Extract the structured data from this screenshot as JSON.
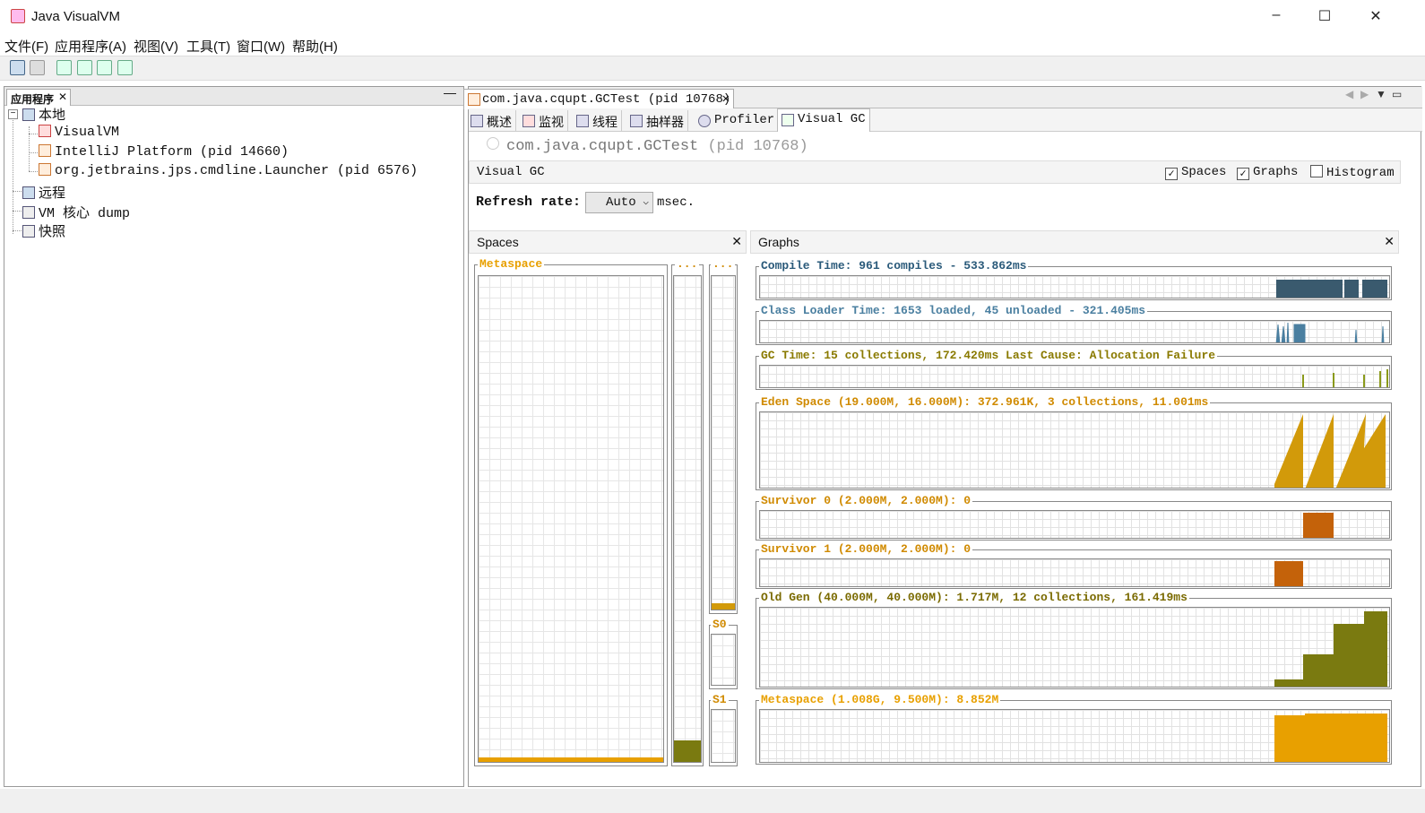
{
  "window": {
    "title": "Java VisualVM",
    "min": "‒",
    "max": "☐",
    "close": "✕"
  },
  "menu": [
    "文件(F)",
    "应用程序(A)",
    "视图(V)",
    "工具(T)",
    "窗口(W)",
    "帮助(H)"
  ],
  "left": {
    "tab_label": "应用程序",
    "tree": {
      "local": "本地",
      "visualvm": "VisualVM",
      "intellij": "IntelliJ Platform (pid 14660)",
      "launcher": "org.jetbrains.jps.cmdline.Launcher (pid 6576)",
      "remote": "远程",
      "coredump": "VM 核心 dump",
      "snapshot": "快照"
    }
  },
  "doc": {
    "tab_label": "com.java.cqupt.GCTest (pid 10768)",
    "subtabs": [
      "概述",
      "监视",
      "线程",
      "抽样器",
      "Profiler",
      "Visual GC"
    ],
    "app_title": "com.java.cqupt.GCTest",
    "app_pid": "(pid 10768)",
    "section": "Visual GC",
    "checks": [
      {
        "label": "Spaces",
        "checked": true
      },
      {
        "label": "Graphs",
        "checked": true
      },
      {
        "label": "Histogram",
        "checked": false
      }
    ],
    "refresh_label": "Refresh rate:",
    "refresh_value": "Auto",
    "refresh_unit": "msec."
  },
  "spaces": {
    "header": "Spaces",
    "metaspace": "Metaspace",
    "col1": "...",
    "col2": "...",
    "s0": "S0",
    "s1": "S1",
    "metaspace_fill": 0.01,
    "old_fill": 0.045,
    "eden_fill": 0.02
  },
  "graphs": {
    "header": "Graphs",
    "compile": "Compile Time: 961 compiles - 533.862ms",
    "classloader": "Class Loader Time: 1653 loaded, 45 unloaded - 321.405ms",
    "gc": "GC Time: 15 collections, 172.420ms Last Cause: Allocation Failure",
    "eden": "Eden Space (19.000M, 16.000M): 372.961K, 3 collections, 11.001ms",
    "s0": "Survivor 0 (2.000M, 2.000M): 0",
    "s1": "Survivor 1 (2.000M, 2.000M): 0",
    "old": "Old Gen (40.000M, 40.000M): 1.717M, 12 collections, 161.419ms",
    "meta": "Metaspace (1.008G, 9.500M): 8.852M"
  },
  "colors": {
    "compile": "#3a5a6e",
    "classloader": "#4a7fa0",
    "gc": "#8a9a1a",
    "eden": "#d29a0a",
    "survivor": "#c4620a",
    "old": "#7a7a10",
    "meta": "#e8a000",
    "label_orange": "#d08a00",
    "label_blue": "#2a5a7a",
    "label_olive": "#8a7a00"
  }
}
